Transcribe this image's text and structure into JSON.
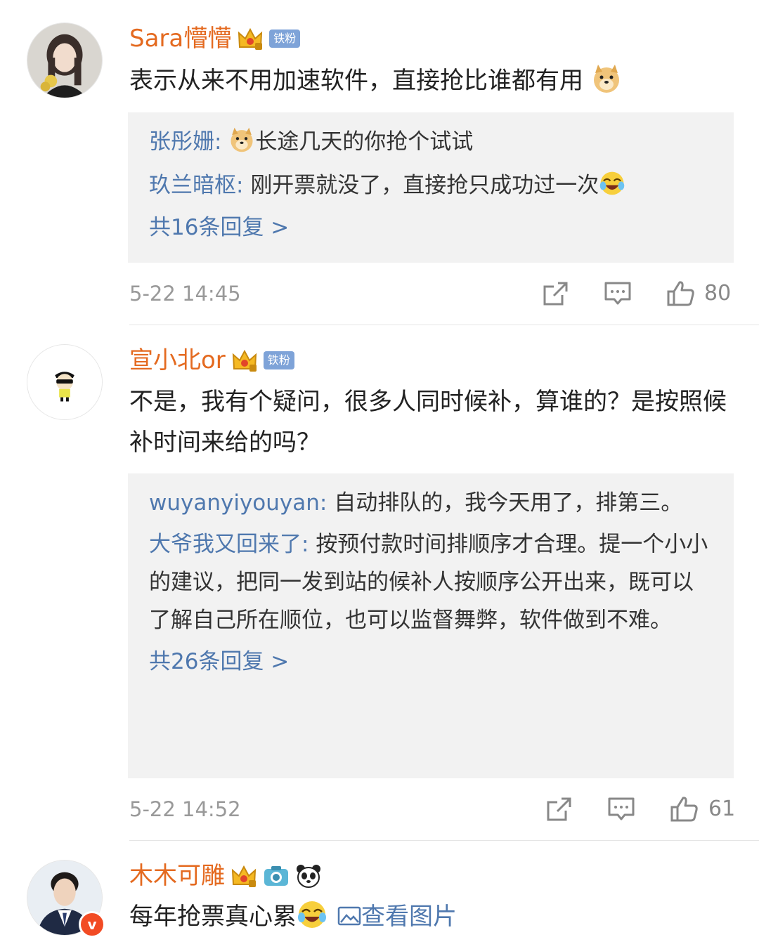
{
  "comments": [
    {
      "user": "Sara懵懵",
      "fan_badge": "铁粉",
      "text": "表示从来不用加速软件，直接抢比谁都有用",
      "replies": [
        {
          "name": "张彤姗:",
          "text": "长途几天的你抢个试试"
        },
        {
          "name": "玖兰暗枢:",
          "text": "刚开票就没了，直接抢只成功过一次"
        }
      ],
      "more": "共16条回复 >",
      "time": "5-22 14:45",
      "likes": "80"
    },
    {
      "user": "宣小北or",
      "fan_badge": "铁粉",
      "text": "不是，我有个疑问，很多人同时候补，算谁的？是按照候补时间来给的吗？",
      "replies": [
        {
          "name": "wuyanyiyouyan:",
          "text": "自动排队的，我今天用了，排第三。"
        },
        {
          "name": "大爷我又回来了:",
          "text": "按预付款时间排顺序才合理。提一个小小的建议，把同一发到站的候补人按顺序公开出来，既可以了解自己所在顺位，也可以监督舞弊，软件做到不难。"
        }
      ],
      "more": "共26条回复 >",
      "time": "5-22 14:52",
      "likes": "61"
    },
    {
      "user": "木木可雕",
      "verified": "v",
      "text": "每年抢票真心累",
      "view_pic": "查看图片"
    }
  ],
  "icons": [
    "crown-icon",
    "doge-emoji",
    "laugh-cry-emoji",
    "share-icon",
    "comment-icon",
    "like-icon",
    "camera-icon",
    "panda-icon",
    "image-icon"
  ],
  "colors": {
    "username": "#e46a20",
    "reply_name": "#4f78ae",
    "reply_bg": "#f2f2f2",
    "fan_badge": "#7ea3d8"
  }
}
